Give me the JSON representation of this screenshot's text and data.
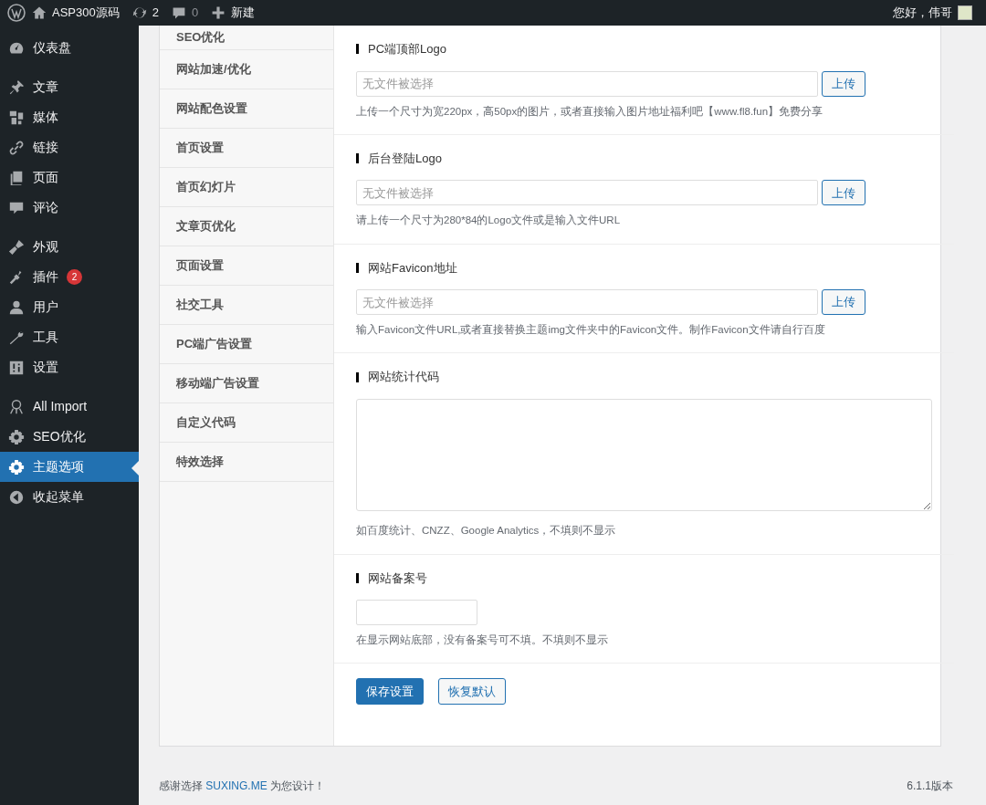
{
  "admin_bar": {
    "site": "ASP300源码",
    "updates": "2",
    "comments": "0",
    "new": "新建",
    "greeting": "您好，伟哥"
  },
  "sidebar": {
    "groups": [
      [
        {
          "label": "仪表盘",
          "selected": false
        }
      ],
      [
        {
          "label": "文章",
          "selected": false
        },
        {
          "label": "媒体",
          "selected": false
        },
        {
          "label": "链接",
          "selected": false
        },
        {
          "label": "页面",
          "selected": false
        },
        {
          "label": "评论",
          "selected": false
        }
      ],
      [
        {
          "label": "外观",
          "selected": false
        },
        {
          "label": "插件",
          "selected": false,
          "badge": "2"
        },
        {
          "label": "用户",
          "selected": false
        },
        {
          "label": "工具",
          "selected": false
        },
        {
          "label": "设置",
          "selected": false
        }
      ],
      [
        {
          "label": "All Import",
          "selected": false
        },
        {
          "label": "SEO优化",
          "selected": false
        },
        {
          "label": "主题选项",
          "selected": true
        },
        {
          "label": "收起菜单",
          "selected": false
        }
      ]
    ]
  },
  "options_nav": [
    {
      "label": "SEO优化",
      "selected": false
    },
    {
      "label": "网站加速/优化",
      "selected": false
    },
    {
      "label": "网站配色设置",
      "selected": false
    },
    {
      "label": "首页设置",
      "selected": false
    },
    {
      "label": "首页幻灯片",
      "selected": false
    },
    {
      "label": "文章页优化",
      "selected": false
    },
    {
      "label": "页面设置",
      "selected": false
    },
    {
      "label": "社交工具",
      "selected": false
    },
    {
      "label": "PC端广告设置",
      "selected": false
    },
    {
      "label": "移动端广告设置",
      "selected": false
    },
    {
      "label": "自定义代码",
      "selected": false
    },
    {
      "label": "特效选择",
      "selected": false
    }
  ],
  "sections": [
    {
      "kind": "upload",
      "title": "PC端顶部Logo",
      "placeholder": "无文件被选择",
      "button": "上传",
      "help": "上传一个尺寸为宽220px，高50px的图片，或者直接输入图片地址福利吧【www.fl8.fun】免费分享"
    },
    {
      "kind": "upload",
      "title": "后台登陆Logo",
      "placeholder": "无文件被选择",
      "button": "上传",
      "help": "请上传一个尺寸为280*84的Logo文件或是输入文件URL"
    },
    {
      "kind": "upload",
      "title": "网站Favicon地址",
      "placeholder": "无文件被选择",
      "button": "上传",
      "help": "输入Favicon文件URL,或者直接替换主题img文件夹中的Favicon文件。制作Favicon文件请自行百度"
    },
    {
      "kind": "textarea",
      "title": "网站统计代码",
      "help": "如百度统计、CNZZ、Google Analytics，不填则不显示"
    },
    {
      "kind": "text",
      "title": "网站备案号",
      "help": "在显示网站底部，没有备案号可不填。不填则不显示"
    }
  ],
  "actions": {
    "save": "保存设置",
    "reset": "恢复默认"
  },
  "footer": {
    "before": "感谢选择 ",
    "link": "SUXING.ME",
    "after": " 为您设计！",
    "version": "6.1.1版本"
  }
}
